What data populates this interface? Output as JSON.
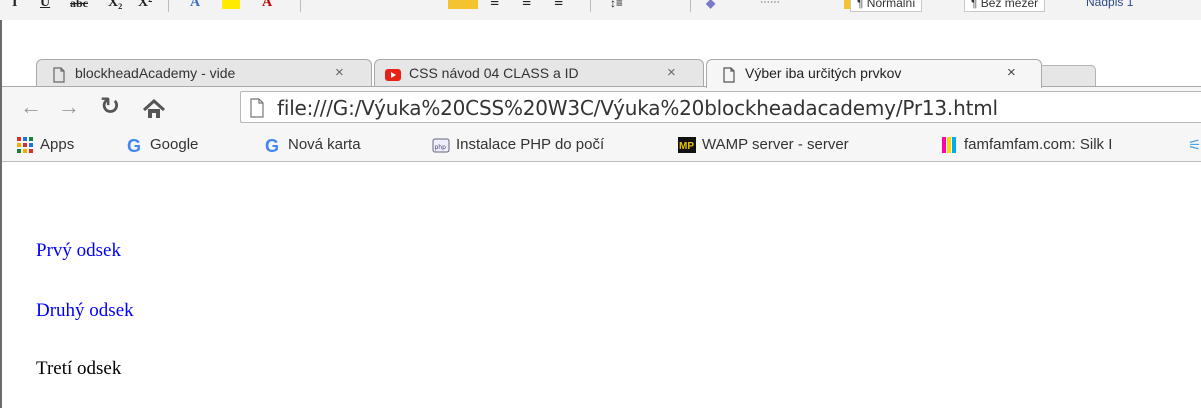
{
  "word_toolbar": {
    "style_normal": "¶ Normální",
    "style_nospacing": "¶ Bez mezer",
    "style_heading": "Nadpis 1"
  },
  "tabs": [
    {
      "label": "blockheadAcademy - vide",
      "favicon": "page-icon",
      "close": "×"
    },
    {
      "label": "CSS návod 04 CLASS a ID",
      "favicon": "youtube-icon",
      "close": "×"
    },
    {
      "label": "Výber iba určitých prvkov",
      "favicon": "page-icon",
      "close": "×",
      "active": true
    }
  ],
  "address_bar": {
    "url": "file:///G:/Výuka%20CSS%20W3C/Výuka%20blockheadacademy/Pr13.html"
  },
  "bookmarks": [
    {
      "label": "Apps",
      "icon": "apps-grid-icon"
    },
    {
      "label": "Google",
      "icon": "google-icon"
    },
    {
      "label": "Nová karta",
      "icon": "google-icon"
    },
    {
      "label": "Instalace PHP do počí",
      "icon": "php-icon"
    },
    {
      "label": "WAMP server - server",
      "icon": "wamp-icon"
    },
    {
      "label": "famfamfam.com: Silk I",
      "icon": "famfamfam-icon"
    }
  ],
  "content": {
    "paragraphs": [
      {
        "text": "Prvý odsek",
        "color": "#0000ff"
      },
      {
        "text": "Druhý odsek",
        "color": "#0000ff"
      },
      {
        "text": "Tretí odsek",
        "color": "#000000"
      }
    ]
  }
}
